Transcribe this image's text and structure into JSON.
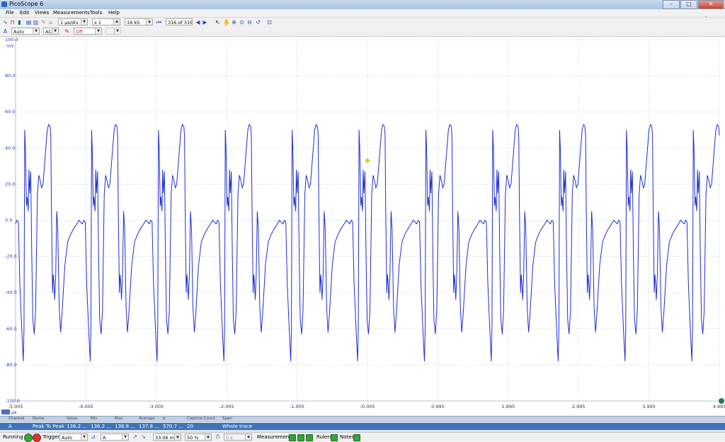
{
  "window": {
    "title": "PicoScope 6",
    "buttons": [
      "–",
      "□",
      "✕"
    ]
  },
  "menu": [
    "File",
    "Edit",
    "Views",
    "Measurements",
    "Tools",
    "Help"
  ],
  "logo": {
    "text": "pico",
    "sub": "Technology"
  },
  "toolbar": {
    "timebase": "1 µs/div",
    "zoom": "x 1",
    "samples": "16 kS",
    "buffer": "316 of 316"
  },
  "channel_bar": {
    "range": "Auto",
    "coupling": "AC",
    "off_label": "Off"
  },
  "chart_data": {
    "type": "line",
    "title": "",
    "ylabel": "mV",
    "xlabel": "µs",
    "y_ticks": [
      "100.0",
      "80.0",
      "60.0",
      "40.0",
      "20.0",
      "0.0",
      "-20.0",
      "-40.0",
      "-60.0",
      "-80.0",
      "-100.0"
    ],
    "x_ticks": [
      "-5.005",
      "-4.005",
      "-3.005",
      "-2.005",
      "-1.005",
      "-0.005",
      "0.995",
      "1.995",
      "2.995",
      "3.995",
      "4.995"
    ],
    "xlim": [
      -5.005,
      4.995
    ],
    "ylim": [
      -100,
      100
    ],
    "grid": true,
    "trace_color": "#1f2fd0",
    "series": [
      {
        "period_us": 0.95,
        "phase_us": -5.005,
        "cycle_shape": [
          [
            0.0,
            -2
          ],
          [
            0.02,
            0
          ],
          [
            0.04,
            -1
          ],
          [
            0.06,
            -35
          ],
          [
            0.09,
            -62
          ],
          [
            0.11,
            -78
          ],
          [
            0.12,
            -60
          ],
          [
            0.13,
            50
          ],
          [
            0.14,
            40
          ],
          [
            0.155,
            8
          ],
          [
            0.165,
            13
          ],
          [
            0.18,
            5
          ],
          [
            0.19,
            28
          ],
          [
            0.2,
            15
          ],
          [
            0.215,
            27
          ],
          [
            0.23,
            -20
          ],
          [
            0.245,
            -55
          ],
          [
            0.265,
            -63
          ],
          [
            0.285,
            -50
          ],
          [
            0.31,
            14
          ],
          [
            0.33,
            25
          ],
          [
            0.35,
            22
          ],
          [
            0.37,
            18
          ],
          [
            0.39,
            20
          ],
          [
            0.42,
            35
          ],
          [
            0.45,
            50
          ],
          [
            0.47,
            53
          ],
          [
            0.49,
            52
          ],
          [
            0.5,
            47
          ],
          [
            0.51,
            5
          ],
          [
            0.525,
            -40
          ],
          [
            0.535,
            -30
          ],
          [
            0.545,
            -35
          ],
          [
            0.555,
            -44
          ],
          [
            0.57,
            -30
          ],
          [
            0.585,
            5
          ],
          [
            0.6,
            -5
          ],
          [
            0.62,
            -48
          ],
          [
            0.64,
            -62
          ],
          [
            0.66,
            -52
          ],
          [
            0.7,
            -25
          ],
          [
            0.74,
            -12
          ],
          [
            0.78,
            -8
          ],
          [
            0.82,
            -5
          ],
          [
            0.87,
            -2
          ],
          [
            0.9,
            0
          ],
          [
            0.95,
            -2
          ]
        ]
      }
    ],
    "trigger_marker": {
      "x": -0.005,
      "y": 33.06,
      "color": "#e8d200"
    },
    "right_marker_color": "#1e7a64"
  },
  "measurements": {
    "headers": [
      "Channel",
      "Name",
      "Value",
      "Min",
      "Max",
      "Average",
      "σ",
      "Capture Count",
      "Span"
    ],
    "row": [
      "A",
      "Peak To Peak",
      "136.2 ...",
      "136.2 ...",
      "138.8 ...",
      "137.8 ...",
      "570.7 ...",
      "20",
      "Whole trace"
    ]
  },
  "status": {
    "state": "Running",
    "trigger_label": "Trigger",
    "trigger_mode": "Auto",
    "trigger_channel": "A",
    "trigger_level": "33.06 mV",
    "pretrigger": "50 %",
    "delay": "0 s",
    "measurements_label": "Measurements",
    "rulers_label": "Rulers",
    "notes_label": "Notes"
  }
}
